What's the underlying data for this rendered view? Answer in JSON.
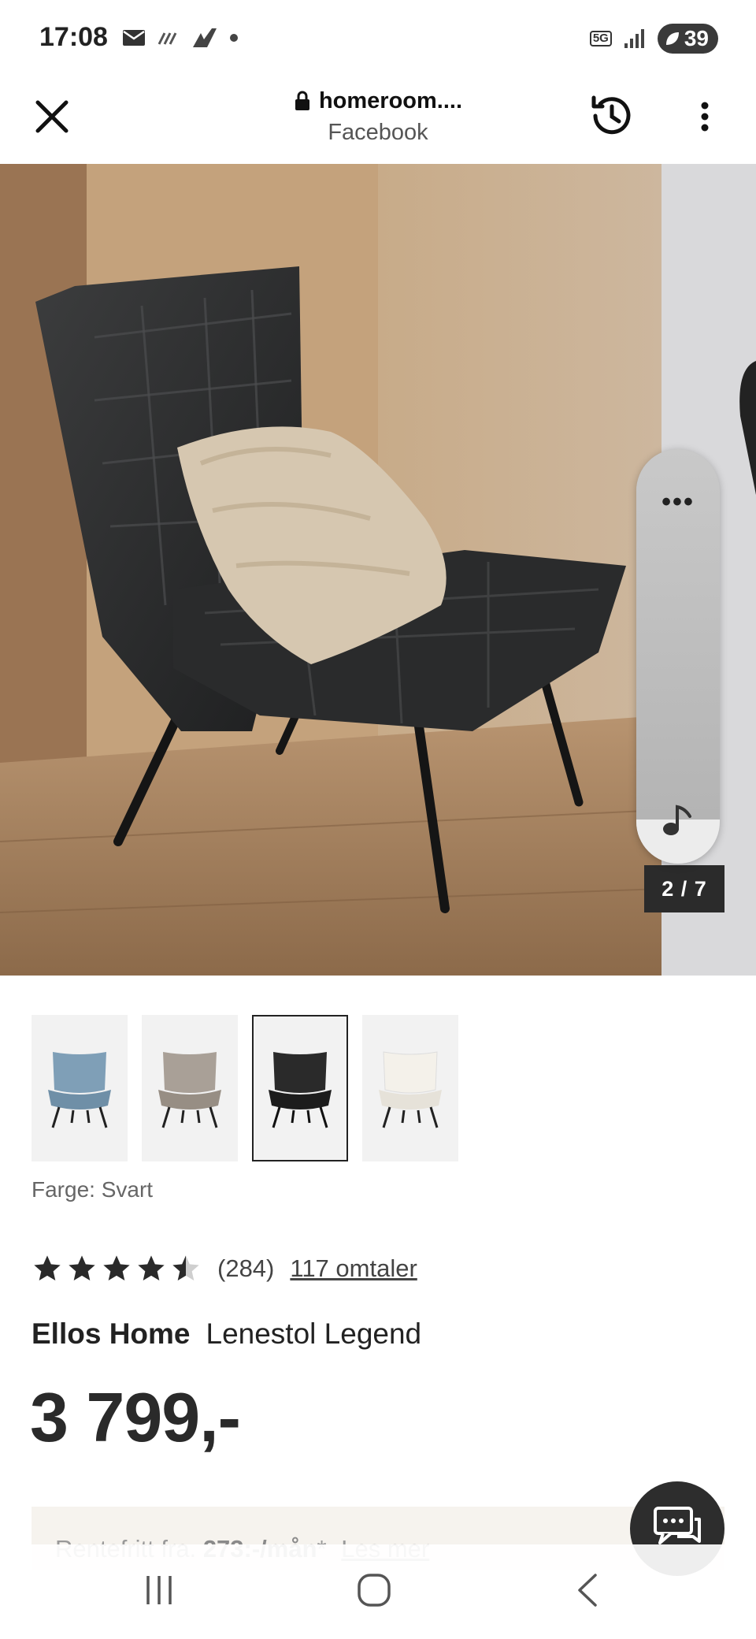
{
  "status": {
    "time": "17:08",
    "network": "5G",
    "battery": "39",
    "colors": {
      "battery_bg": "#3a3a3a"
    }
  },
  "browser": {
    "url": "homeroom....",
    "source": "Facebook",
    "icons": {
      "close": "close-icon",
      "lock": "lock-icon",
      "history": "history-icon",
      "menu": "more-vertical-icon"
    }
  },
  "gallery": {
    "counter": "2 / 7",
    "current": 2,
    "total": 7
  },
  "side_panel": {
    "menu_label": "•••",
    "icon": "music-note-icon"
  },
  "product": {
    "color_label": "Farge: Svart",
    "thumbnails": [
      {
        "name": "blue",
        "color": "#7f9fb7"
      },
      {
        "name": "beige",
        "color": "#a9a097"
      },
      {
        "name": "black",
        "color": "#2a2a2a"
      },
      {
        "name": "white",
        "color": "#eeebe4"
      }
    ],
    "selected_thumbnail": 3,
    "rating_value": 4.5,
    "rating_count": "(284)",
    "reviews_link": "117 omtaler",
    "brand": "Ellos Home",
    "name": "Lenestol Legend",
    "price": "3 799,-"
  },
  "finance": {
    "prefix": "Rentefritt fra.",
    "amount": "273:-/mån",
    "suffix": "*",
    "link": "Les mer"
  },
  "chat": {
    "icon": "chat-icon"
  },
  "nav": {
    "icons": [
      "recent-apps-icon",
      "home-icon",
      "back-icon"
    ]
  }
}
